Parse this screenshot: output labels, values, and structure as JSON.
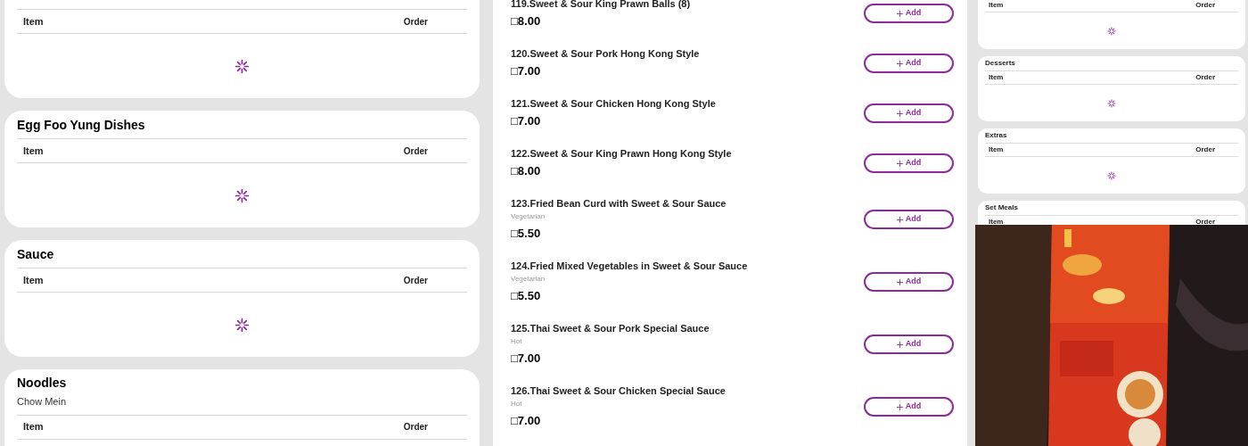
{
  "left_sections": [
    {
      "columns": [
        "Item",
        "Order"
      ],
      "loading": true
    },
    {
      "title": "Egg Foo Yung Dishes",
      "columns": [
        "Item",
        "Order"
      ],
      "loading": true
    },
    {
      "title": "Sauce",
      "columns": [
        "Item",
        "Order"
      ],
      "loading": true
    },
    {
      "title": "Noodles",
      "subtitle": "Chow Mein",
      "columns": [
        "Item",
        "Order"
      ],
      "loading": false
    }
  ],
  "menu_items": [
    {
      "name": "119.Sweet & Sour King Prawn Balls (8)",
      "price": "□8.00",
      "button": "Add"
    },
    {
      "name": "120.Sweet & Sour Pork Hong Kong Style",
      "price": "□7.00",
      "button": "Add"
    },
    {
      "name": "121.Sweet & Sour Chicken Hong Kong Style",
      "price": "□7.00",
      "button": "Add"
    },
    {
      "name": "122.Sweet & Sour King Prawn Hong Kong Style",
      "price": "□8.00",
      "button": "Add"
    },
    {
      "name": "123.Fried Bean Curd with Sweet & Sour Sauce",
      "tag": "Vegetarian",
      "price": "□5.50",
      "button": "Add"
    },
    {
      "name": "124.Fried Mixed Vegetables in Sweet & Sour Sauce",
      "tag": "Vegetarian",
      "price": "□5.50",
      "button": "Add"
    },
    {
      "name": "125.Thai Sweet & Sour Pork Special Sauce",
      "tag": "Hot",
      "price": "□7.00",
      "button": "Add"
    },
    {
      "name": "126.Thai Sweet & Sour Chicken Special Sauce",
      "tag": "Hot",
      "price": "□7.00",
      "button": "Add"
    }
  ],
  "right_sections": [
    {
      "columns": [
        "Item",
        "Order"
      ],
      "loading": true
    },
    {
      "title": "Desserts",
      "columns": [
        "Item",
        "Order"
      ],
      "loading": true
    },
    {
      "title": "Extras",
      "columns": [
        "Item",
        "Order"
      ],
      "loading": true
    },
    {
      "title": "Set Meals",
      "columns": [
        "Item",
        "Order"
      ],
      "loading": false
    }
  ]
}
